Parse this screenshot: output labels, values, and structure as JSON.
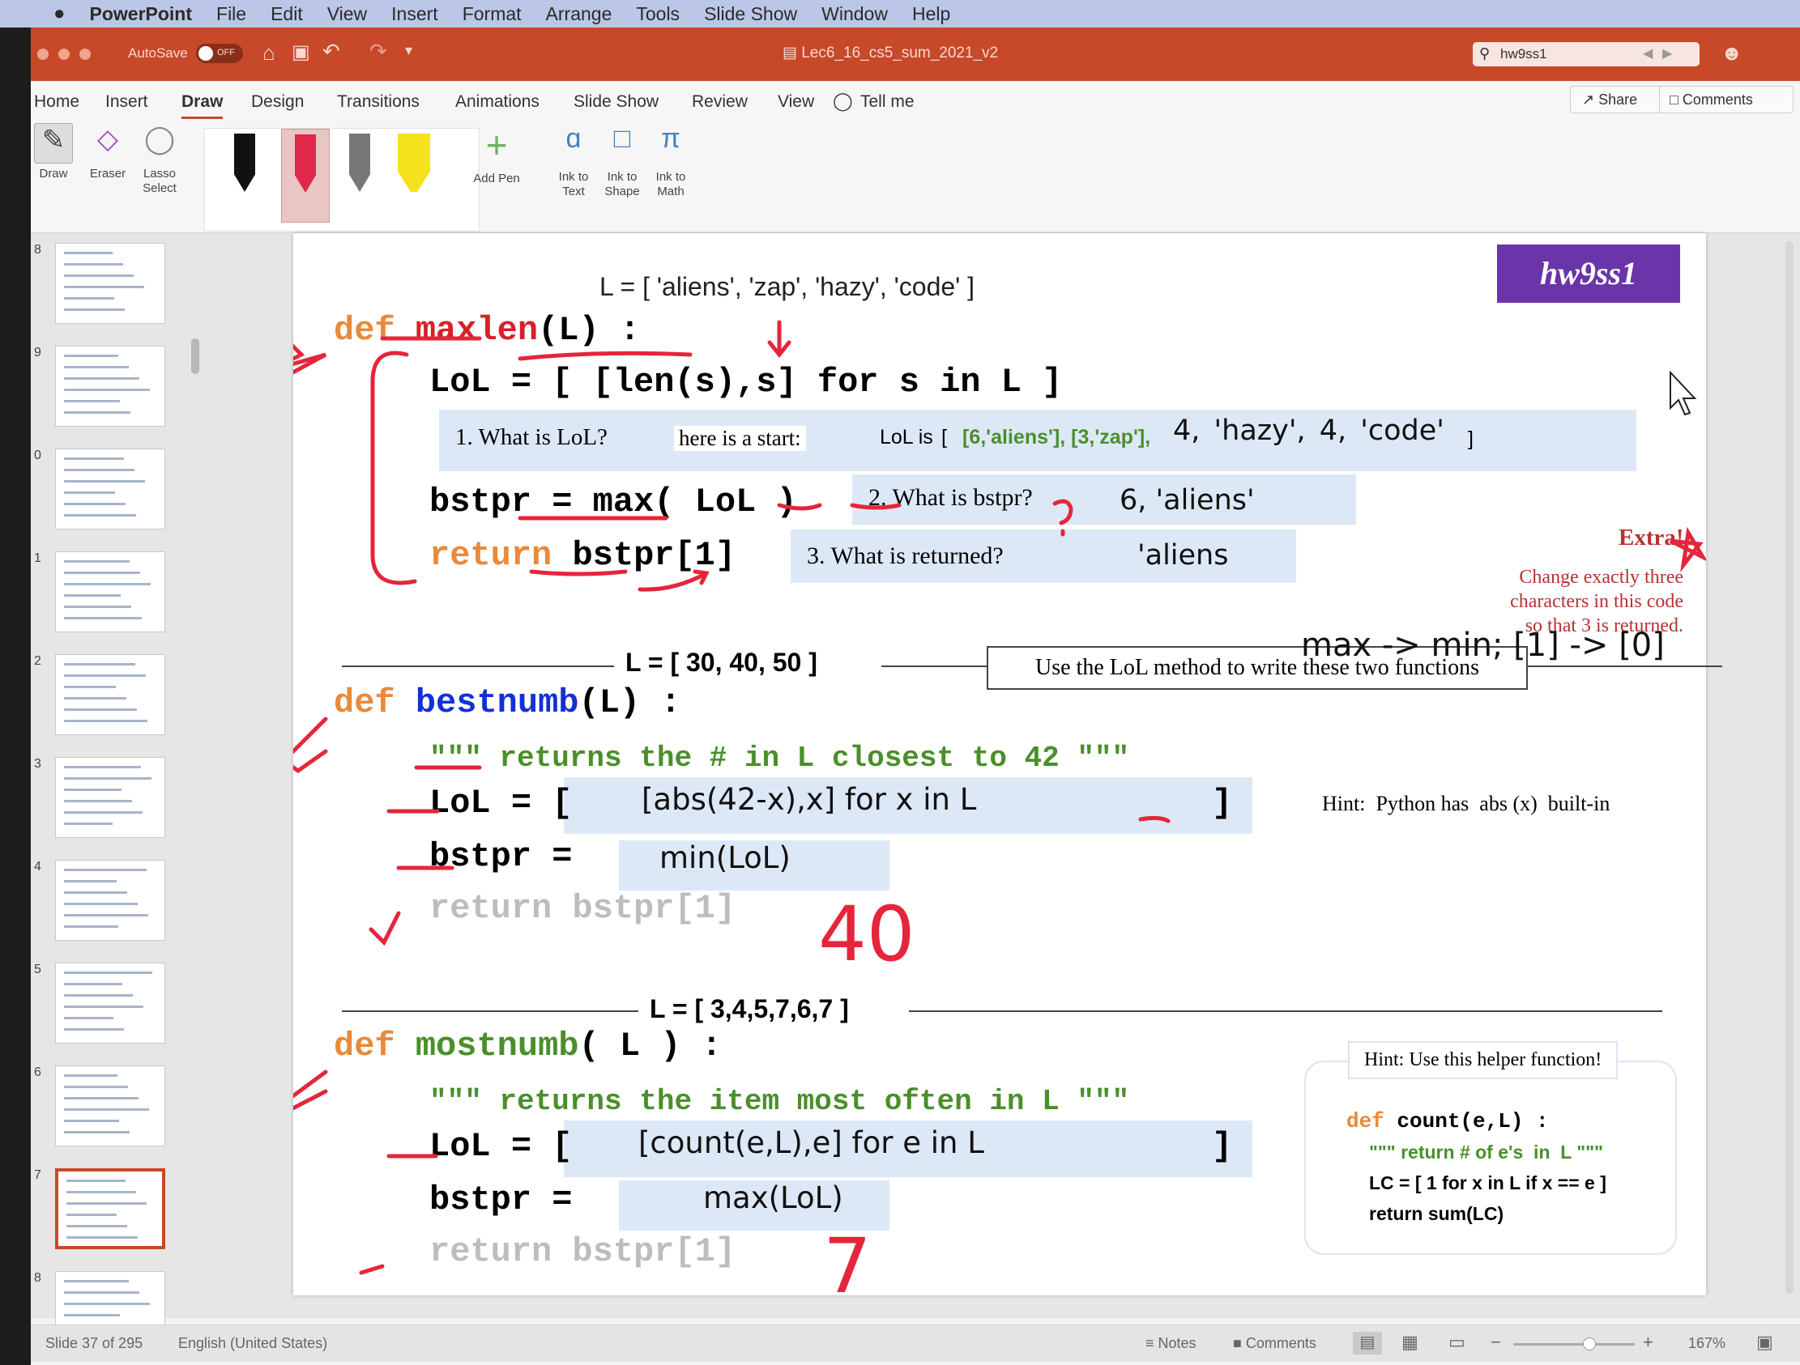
{
  "menubar": {
    "app": "PowerPoint",
    "items": [
      "File",
      "Edit",
      "View",
      "Insert",
      "Format",
      "Arrange",
      "Tools",
      "Slide Show",
      "Window",
      "Help"
    ]
  },
  "titlebar": {
    "autosave": "AutoSave",
    "autosave_state": "OFF",
    "doc_title": "Lec6_16_cs5_sum_2021_v2",
    "search_value": "hw9ss1"
  },
  "ribbon_tabs": {
    "tabs": [
      "Home",
      "Insert",
      "Draw",
      "Design",
      "Transitions",
      "Animations",
      "Slide Show",
      "Review",
      "View"
    ],
    "active": "Draw",
    "tell_me": "Tell me",
    "share": "Share",
    "comments": "Comments"
  },
  "ribbon": {
    "draw": "Draw",
    "eraser": "Eraser",
    "lasso": "Lasso Select",
    "add_pen": "Add Pen",
    "ink_text": "Ink to Text",
    "ink_shape": "Ink to Shape",
    "ink_math": "Ink to Math"
  },
  "thumbnails": {
    "numbers": [
      "8",
      "9",
      "0",
      "1",
      "2",
      "3",
      "4",
      "5",
      "6",
      "7",
      "8"
    ],
    "active_index": 9
  },
  "slide": {
    "tag": "hw9ss1",
    "l1": "L = [ 'aliens', 'zap', 'hazy', 'code' ]",
    "def_kw": "def",
    "maxlen_name": "maxlen",
    "maxlen_args": "(L) :",
    "lol_line": "LoL = [ [len(s),s] for s in L ]",
    "q1": "1. What is LoL?",
    "start": "here is a start:",
    "lol_is": "LoL is",
    "lol_bracket": "[",
    "lol_start_val": "[6,'aliens'], [3,'zap'],",
    "lol_hand": "4, 'hazy', 4, 'code'",
    "lol_close": "]",
    "bstpr_line_a": "bstpr = ",
    "bstpr_max": "max(",
    "bstpr_lol": " LoL",
    "bstpr_close": " )",
    "q2": "2. What is bstpr?",
    "a2": "6, 'aliens'",
    "ret_kw": "return",
    "ret_expr": "bstpr[1]",
    "q3": "3. What is returned?",
    "a3": "'aliens",
    "extra_title": "Extra!",
    "extra_body1": "Change exactly three",
    "extra_body2": "characters in this code",
    "extra_body3": "so that 3 is returned.",
    "extra_hand": "max -> min; [1] -> [0]",
    "l2": "L = [ 30, 40, 50 ]",
    "lol_method": "Use the LoL method to write these two functions",
    "bestnumb_name": "bestnumb",
    "bestnumb_args": "(L) :",
    "bestnumb_doc": "\"\"\" returns the # in L closest to 42 \"\"\"",
    "lol_eq": "LoL = [",
    "bestnumb_lol_val": "[abs(42-x),x] for x in L",
    "close_bracket": "]",
    "bstpr_eq": "bstpr =",
    "bestnumb_bstpr_val": "min(LoL)",
    "ret_dim": "return bstpr[1]",
    "hint1": "Hint:  Python has  abs (x)  built-in",
    "hand_40": "40",
    "l3": "L = [ 3,4,5,7,6,7 ]",
    "mostnumb_name": "mostnumb",
    "mostnumb_args": "( L ) :",
    "mostnumb_doc": "\"\"\" returns the item most often in L \"\"\"",
    "mostnumb_lol_val": "[count(e,L),e] for e in L",
    "mostnumb_bstpr_val": "max(LoL)",
    "hand_7": "7",
    "hint2": "Hint: Use this helper function!",
    "helper_def": "def",
    "helper_sig": "count(e,L) :",
    "helper_doc": "\"\"\" return # of e's  in  L \"\"\"",
    "helper_lc": "LC = [ 1 for x in L if x == e ]",
    "helper_ret": "return sum(LC)"
  },
  "status": {
    "slide_of": "Slide 37 of 295",
    "language": "English (United States)",
    "notes": "Notes",
    "comments": "Comments",
    "zoom": "167%"
  },
  "colors": {
    "title_bar": "#c8482a",
    "keyword": "#e98a3a",
    "function_red": "#d6212b",
    "function_blue": "#1330d6",
    "tag_bg": "#6a35a8",
    "ink_red": "#e5263a"
  }
}
